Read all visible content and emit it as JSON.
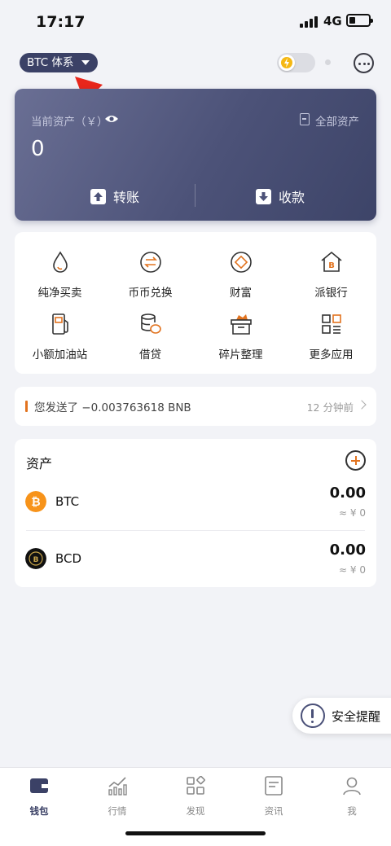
{
  "status_bar": {
    "time": "17:17",
    "network": "4G"
  },
  "header": {
    "system_selector": "BTC 体系"
  },
  "asset_card": {
    "label": "当前资产（￥）",
    "all_assets_link": "全部资产",
    "value": "0",
    "transfer_label": "转账",
    "receive_label": "收款"
  },
  "quick_actions": [
    {
      "label": "纯净买卖",
      "icon": "drop-icon"
    },
    {
      "label": "币币兑换",
      "icon": "exchange-icon"
    },
    {
      "label": "财富",
      "icon": "wealth-icon"
    },
    {
      "label": "派银行",
      "icon": "bank-icon"
    },
    {
      "label": "小额加油站",
      "icon": "gas-station-icon"
    },
    {
      "label": "借贷",
      "icon": "coins-icon"
    },
    {
      "label": "碎片整理",
      "icon": "box-icon"
    },
    {
      "label": "更多应用",
      "icon": "apps-grid-icon"
    }
  ],
  "notice": {
    "text": "您发送了 −0.003763618 BNB",
    "time": "12 分钟前"
  },
  "assets": {
    "title": "资产",
    "coins": [
      {
        "symbol": "BTC",
        "amount": "0.00",
        "fiat": "≈ ¥ 0",
        "color": "#f7931a"
      },
      {
        "symbol": "BCD",
        "amount": "0.00",
        "fiat": "≈ ¥ 0",
        "color": "#111111"
      }
    ]
  },
  "safety_reminder": {
    "label": "安全提醒"
  },
  "tabs": [
    {
      "label": "钱包",
      "icon": "wallet-icon",
      "active": true
    },
    {
      "label": "行情",
      "icon": "chart-icon",
      "active": false
    },
    {
      "label": "发现",
      "icon": "discover-icon",
      "active": false
    },
    {
      "label": "资讯",
      "icon": "news-icon",
      "active": false
    },
    {
      "label": "我",
      "icon": "profile-icon",
      "active": false
    }
  ],
  "colors": {
    "accent": "#e2731f",
    "brand": "#3b4166",
    "annotation_arrow": "#e8261b"
  }
}
